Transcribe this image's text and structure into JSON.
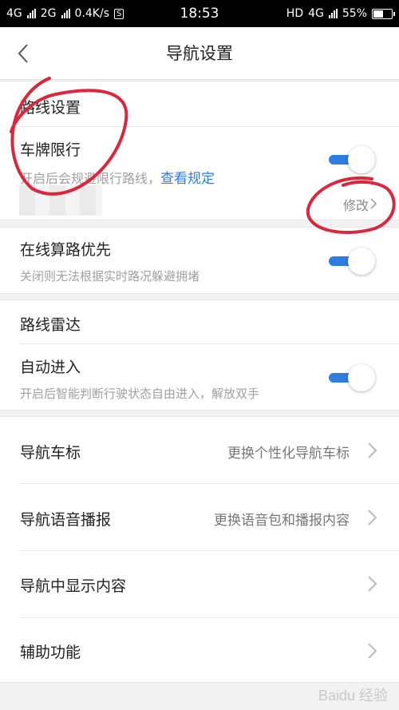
{
  "status_bar": {
    "network1": "4G",
    "network2": "2G",
    "speed": "0.4K/s",
    "s_badge": "S",
    "time": "18:53",
    "hd": "HD",
    "net_right": "4G",
    "battery_text": "55%",
    "battery_level": 0.55
  },
  "header": {
    "title": "导航设置"
  },
  "route_settings": {
    "section_title": "路线设置",
    "plate_limit": {
      "title": "车牌限行",
      "subtitle": "开启后会规避限行路线，",
      "link": "查看规定",
      "modify": "修改",
      "enabled": true
    },
    "online_calc": {
      "title": "在线算路优先",
      "subtitle": "关闭则无法根据实时路况躲避拥堵",
      "enabled": true
    }
  },
  "route_radar": {
    "section_title": "路线雷达",
    "auto_enter": {
      "title": "自动进入",
      "subtitle": "开启后智能判断行驶状态自由进入，解放双手",
      "enabled": true
    }
  },
  "menu": [
    {
      "title": "导航车标",
      "value": "更换个性化导航车标"
    },
    {
      "title": "导航语音播报",
      "value": "更换语音包和播报内容"
    },
    {
      "title": "导航中显示内容",
      "value": ""
    },
    {
      "title": "辅助功能",
      "value": ""
    }
  ],
  "watermark": "Baidu 经验",
  "colors": {
    "accent": "#2f7de1",
    "annotation": "#d8283c"
  }
}
